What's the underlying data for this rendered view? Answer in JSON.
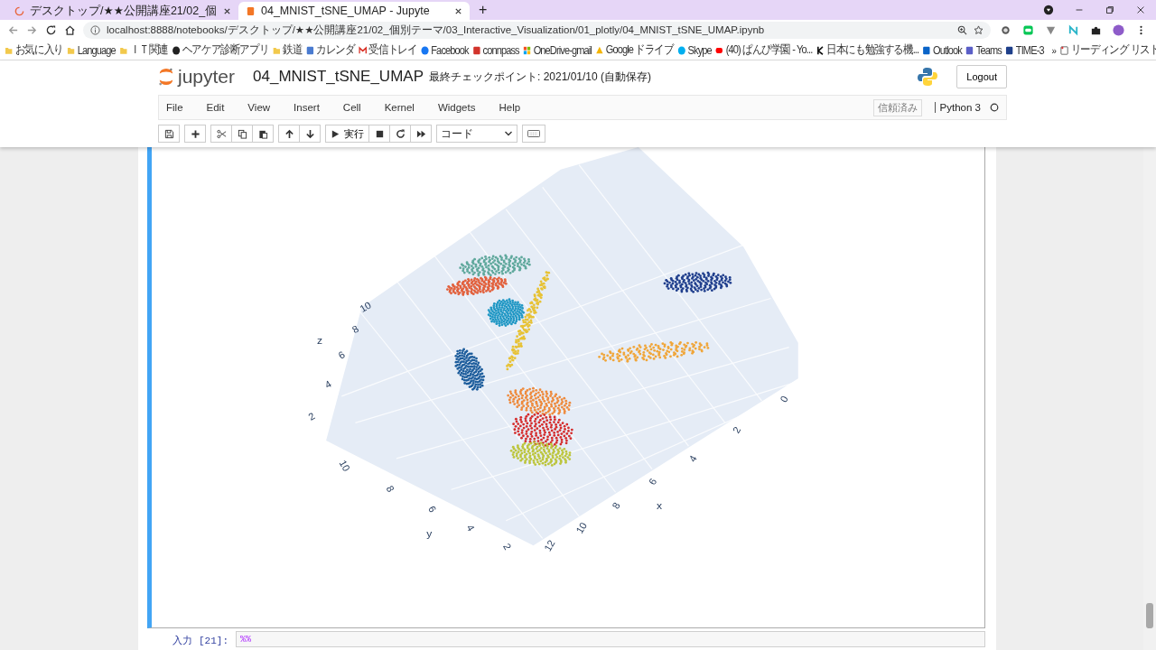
{
  "browser": {
    "tabs": [
      {
        "title": "デスクトップ/★★公開講座21/02_個",
        "selected": false,
        "kind": "spinner"
      },
      {
        "title": "04_MNIST_tSNE_UMAP - Jupyte",
        "selected": true,
        "kind": "jupyter"
      }
    ],
    "new_tab": "+",
    "url": "localhost:8888/notebooks/デスクトップ/★★公開講座21/02_個別テーマ/03_Interactive_Visualization/01_plotly/04_MNIST_tSNE_UMAP.ipynb",
    "bookmarks": [
      {
        "label": "お気に入り",
        "kind": "folder"
      },
      {
        "label": "Language",
        "kind": "folder"
      },
      {
        "label": "ＩＴ関連",
        "kind": "folder"
      },
      {
        "label": "ヘアケア診断アプリ",
        "kind": "globe"
      },
      {
        "label": "鉄道",
        "kind": "folder"
      },
      {
        "label": "カレンダ",
        "kind": "calendar"
      },
      {
        "label": "受信トレイ",
        "kind": "mail"
      },
      {
        "label": "Facebook",
        "kind": "facebook"
      },
      {
        "label": "connpass",
        "kind": "connpass"
      },
      {
        "label": "OneDrive-gmail",
        "kind": "windows"
      },
      {
        "label": "Google ドライブ",
        "kind": "drive"
      },
      {
        "label": "Skype",
        "kind": "skype"
      },
      {
        "label": "(40) ぱんぴ学園 - Yo...",
        "kind": "youtube"
      },
      {
        "label": "日本にも勉強する機...",
        "kind": "k"
      },
      {
        "label": "Outlook",
        "kind": "outlook"
      },
      {
        "label": "Teams",
        "kind": "teams"
      },
      {
        "label": "TIME-3",
        "kind": "time"
      }
    ],
    "more": "»",
    "reading_list": "リーディング リスト"
  },
  "jupyter": {
    "logo": "jupyter",
    "notebook_title": "04_MNIST_tSNE_UMAP",
    "checkpoint": "最終チェックポイント: 2021/01/10  (自動保存)",
    "logout": "Logout",
    "menu": [
      "File",
      "Edit",
      "View",
      "Insert",
      "Cell",
      "Kernel",
      "Widgets",
      "Help"
    ],
    "trusted": "信頼済み",
    "kernel": "Python 3",
    "run_label": "実行",
    "cell_type": "コード"
  },
  "plot": {
    "axes": [
      {
        "title": "z",
        "ticks": [
          "10",
          "8",
          "6",
          "4",
          "2"
        ]
      },
      {
        "title": "y",
        "ticks": [
          "10",
          "8",
          "6",
          "4",
          "2"
        ]
      },
      {
        "title": "x",
        "ticks": [
          "0",
          "2",
          "4",
          "6",
          "8",
          "10",
          "12"
        ]
      }
    ]
  },
  "next_cell": {
    "prompt": "入力 [21]:",
    "code": "%%"
  }
}
